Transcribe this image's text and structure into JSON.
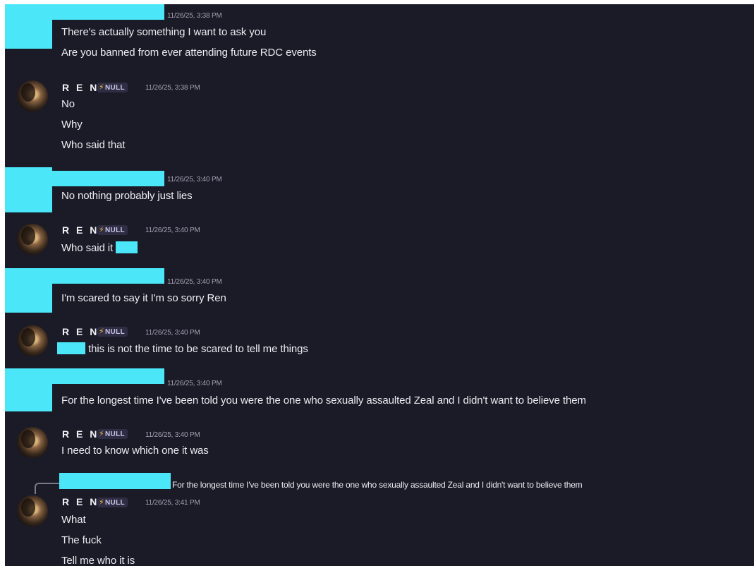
{
  "chat": {
    "messages": [
      {
        "timestamp": "11/26/25, 3:38 PM",
        "lines": [
          "There's actually something I want to ask you",
          "Are you banned from ever attending future RDC events"
        ]
      },
      {
        "username": "R E N",
        "tag": "NULL",
        "timestamp": "11/26/25, 3:38 PM",
        "lines": [
          "No",
          "Why",
          "Who said that"
        ]
      },
      {
        "timestamp": "11/26/25, 3:40 PM",
        "lines": [
          "No nothing probably just lies"
        ]
      },
      {
        "username": "R E N",
        "tag": "NULL",
        "timestamp": "11/26/25, 3:40 PM",
        "lines": [
          "Who said it"
        ]
      },
      {
        "timestamp": "11/26/25, 3:40 PM",
        "lines": [
          "I'm scared to say it I'm so sorry Ren"
        ]
      },
      {
        "username": "R E N",
        "tag": "NULL",
        "timestamp": "11/26/25, 3:40 PM",
        "lines": [
          "this is not the time to be scared to tell me things"
        ]
      },
      {
        "timestamp": "11/26/25, 3:40 PM",
        "lines": [
          "For the longest time I've been told you were the one who sexually assaulted Zeal and I didn't want to believe them"
        ]
      },
      {
        "username": "R E N",
        "tag": "NULL",
        "timestamp": "11/26/25, 3:40 PM",
        "lines": [
          "I need to know which one it was"
        ]
      },
      {
        "reply_preview": "For the longest time I've been told you were the one who sexually assaulted Zeal and I didn't want to believe them",
        "username": "R E N",
        "tag": "NULL",
        "timestamp": "11/26/25, 3:41 PM",
        "lines": [
          "What",
          "The fuck",
          "Tell me who it is"
        ]
      }
    ]
  },
  "icons": {
    "avatar": "user-avatar",
    "bolt": "lightning-bolt-icon",
    "bolt_glyph": "⚡"
  },
  "colors": {
    "background": "#1b1a27",
    "redaction": "#4be7f8",
    "text": "#ececf2",
    "timestamp": "#a3a1b1"
  }
}
